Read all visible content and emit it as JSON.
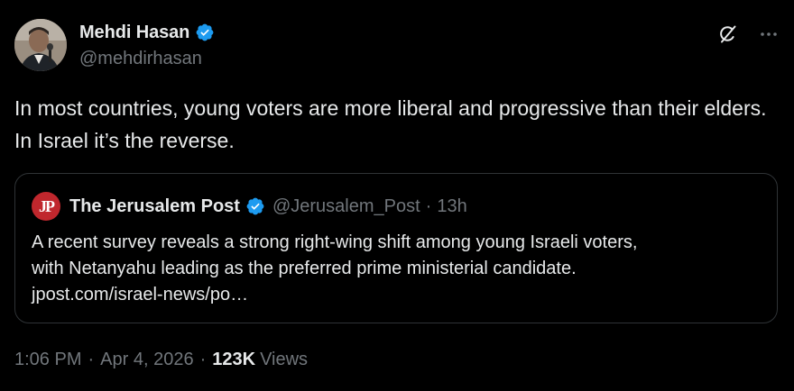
{
  "author": {
    "display_name": "Mehdi Hasan",
    "handle": "@mehdirhasan",
    "verified": true,
    "verified_color": "#1d9bf0"
  },
  "header_icons": [
    "grok-icon",
    "more-icon"
  ],
  "tweet": {
    "text": "In most countries, young voters are more liberal and progressive than their elders. In Israel it’s the reverse."
  },
  "quote": {
    "logo_text": "JP",
    "logo_color": "#c0272d",
    "name": "The Jerusalem Post",
    "handle": "@Jerusalem_Post",
    "separator": "·",
    "time": "13h",
    "lines": [
      "A recent survey reveals a strong right-wing shift among young Israeli voters,",
      "with Netanyahu leading as the preferred prime ministerial candidate.",
      "jpost.com/israel-news/po…"
    ]
  },
  "meta": {
    "time": "1:06 PM",
    "separator": "·",
    "date": "Apr 4, 2026",
    "views_count": "123K",
    "views_label": "Views"
  },
  "colors": {
    "background": "#000000",
    "text_primary": "#e7e9ea",
    "text_secondary": "#71767b",
    "border": "#2f3336"
  }
}
